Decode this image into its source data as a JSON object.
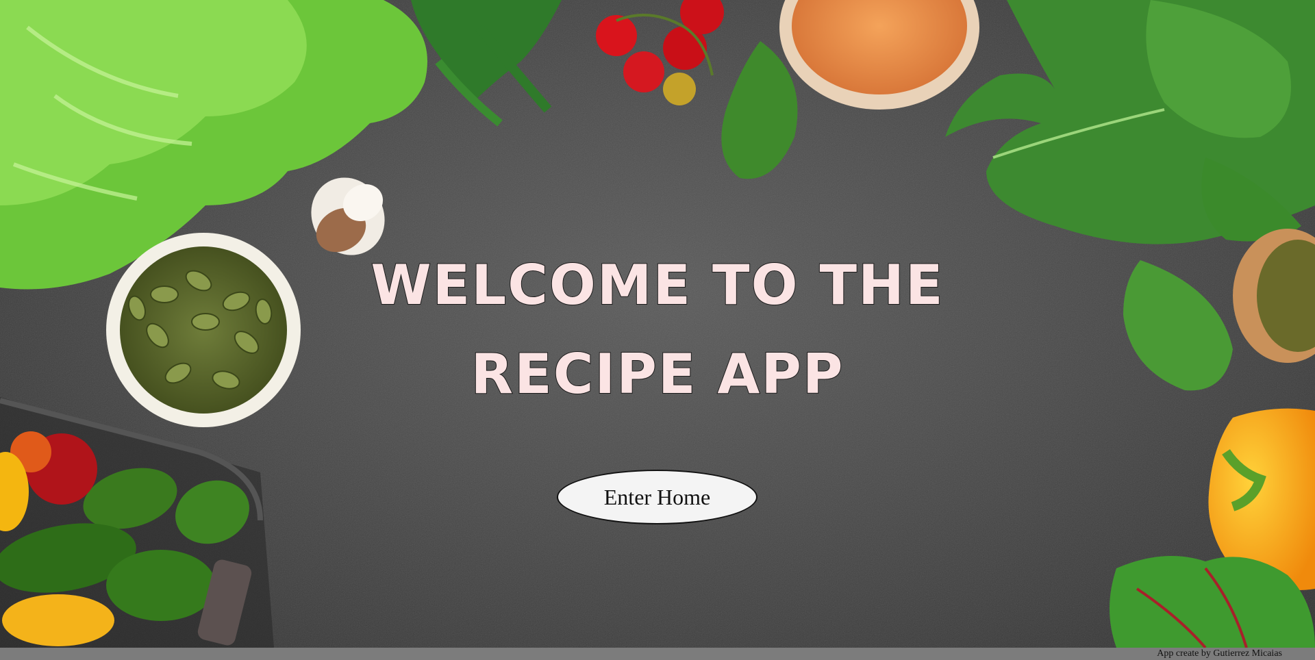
{
  "hero": {
    "title_line1": "WELCOME TO THE",
    "title_line2": "RECIPE APP",
    "enter_button_label": "Enter Home"
  },
  "footer": {
    "credit": "App create by Gutierrez Micaias"
  },
  "colors": {
    "background": "#4a4a4a",
    "title_fill": "#fbe4e4",
    "title_stroke": "#1a1a1a",
    "button_bg": "#f4f4f4",
    "footer_bg": "#7c7c7c"
  }
}
